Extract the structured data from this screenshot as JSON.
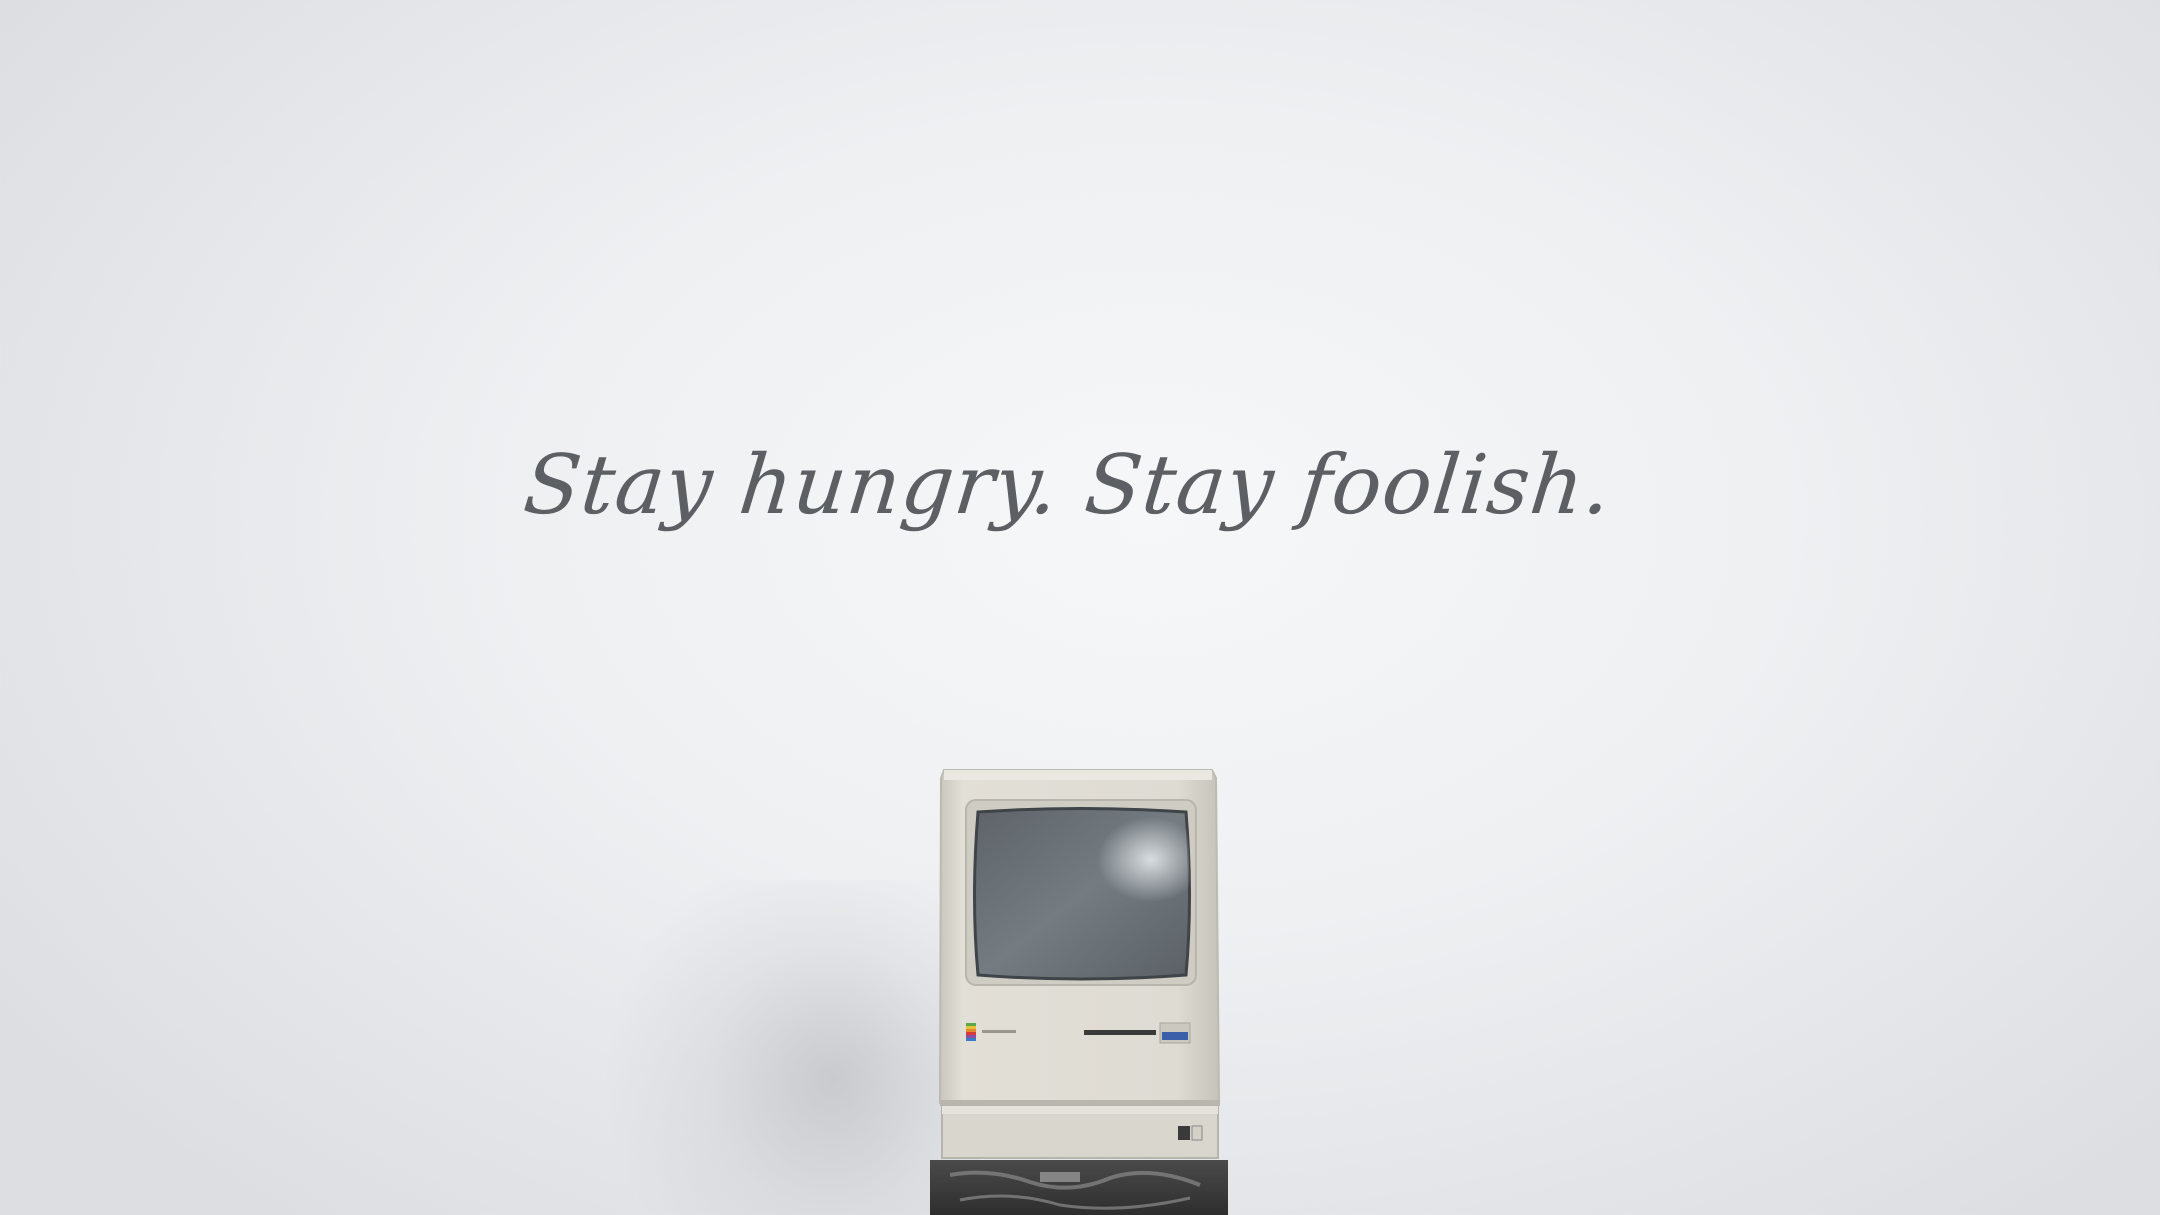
{
  "quote": {
    "text": "Stay hungry. Stay foolish."
  },
  "scene": {
    "background_color": "#eef0f2",
    "text_color": "#5c5f63",
    "computer_case_color": "#dcd9d0",
    "screen_color": "#6e757a",
    "object": "vintage-macintosh-computer-icon"
  }
}
